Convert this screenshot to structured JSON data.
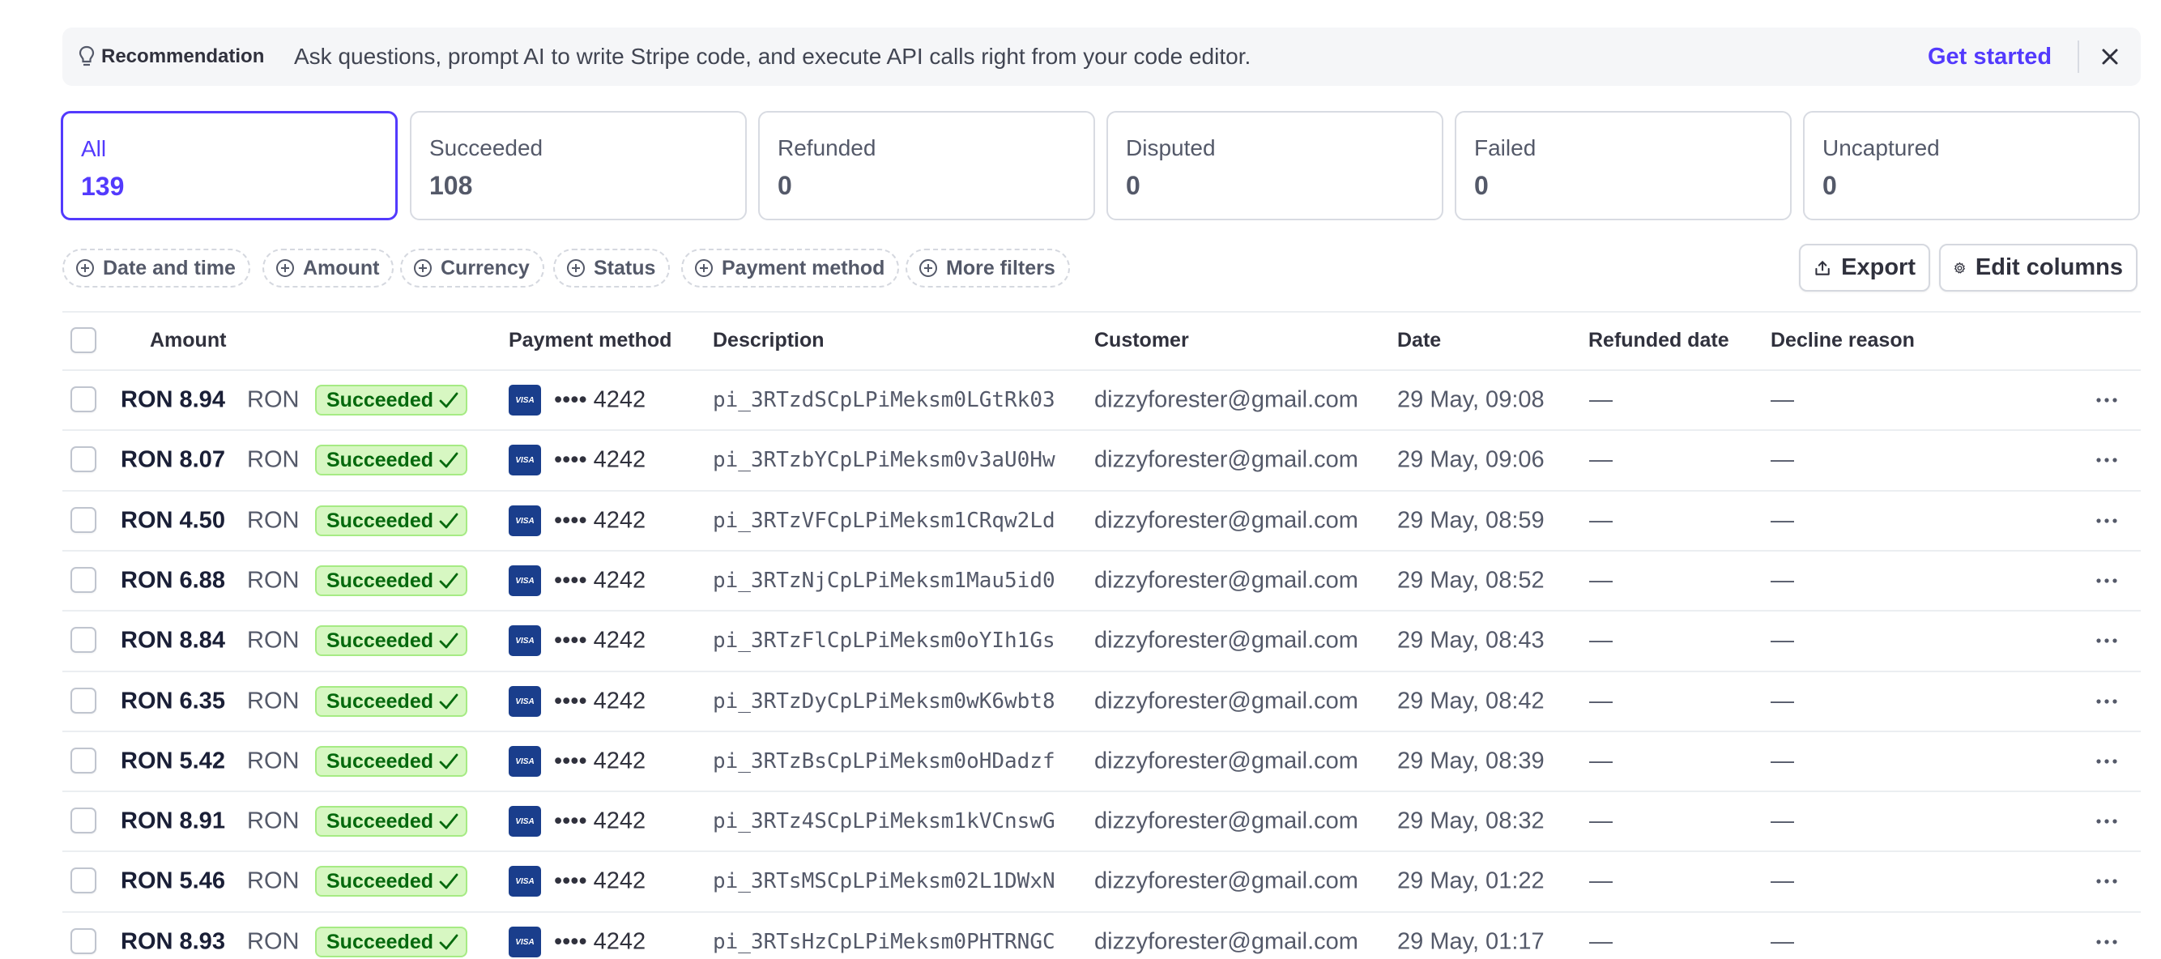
{
  "banner": {
    "label": "Recommendation",
    "text": "Ask questions, prompt AI to write Stripe code, and execute API calls right from your code editor.",
    "link": "Get started"
  },
  "status_cards": [
    {
      "label": "All",
      "count": "139",
      "active": true
    },
    {
      "label": "Succeeded",
      "count": "108",
      "active": false
    },
    {
      "label": "Refunded",
      "count": "0",
      "active": false
    },
    {
      "label": "Disputed",
      "count": "0",
      "active": false
    },
    {
      "label": "Failed",
      "count": "0",
      "active": false
    },
    {
      "label": "Uncaptured",
      "count": "0",
      "active": false
    }
  ],
  "filters": [
    "Date and time",
    "Amount",
    "Currency",
    "Status",
    "Payment method",
    "More filters"
  ],
  "actions": {
    "export": "Export",
    "edit_columns": "Edit columns"
  },
  "table": {
    "headers": {
      "amount": "Amount",
      "payment_method": "Payment method",
      "description": "Description",
      "customer": "Customer",
      "date": "Date",
      "refunded_date": "Refunded date",
      "decline_reason": "Decline reason"
    },
    "rows": [
      {
        "amount": "RON 8.94",
        "currency": "RON",
        "status": "Succeeded",
        "brand": "VISA",
        "last4": "•••• 4242",
        "description": "pi_3RTzdSCpLPiMeksm0LGtRk03",
        "customer": "dizzyforester@gmail.com",
        "date": "29 May, 09:08",
        "refunded_date": "—",
        "decline_reason": "—"
      },
      {
        "amount": "RON 8.07",
        "currency": "RON",
        "status": "Succeeded",
        "brand": "VISA",
        "last4": "•••• 4242",
        "description": "pi_3RTzbYCpLPiMeksm0v3aU0Hw",
        "customer": "dizzyforester@gmail.com",
        "date": "29 May, 09:06",
        "refunded_date": "—",
        "decline_reason": "—"
      },
      {
        "amount": "RON 4.50",
        "currency": "RON",
        "status": "Succeeded",
        "brand": "VISA",
        "last4": "•••• 4242",
        "description": "pi_3RTzVFCpLPiMeksm1CRqw2Ld",
        "customer": "dizzyforester@gmail.com",
        "date": "29 May, 08:59",
        "refunded_date": "—",
        "decline_reason": "—"
      },
      {
        "amount": "RON 6.88",
        "currency": "RON",
        "status": "Succeeded",
        "brand": "VISA",
        "last4": "•••• 4242",
        "description": "pi_3RTzNjCpLPiMeksm1Mau5id0",
        "customer": "dizzyforester@gmail.com",
        "date": "29 May, 08:52",
        "refunded_date": "—",
        "decline_reason": "—"
      },
      {
        "amount": "RON 8.84",
        "currency": "RON",
        "status": "Succeeded",
        "brand": "VISA",
        "last4": "•••• 4242",
        "description": "pi_3RTzFlCpLPiMeksm0oYIh1Gs",
        "customer": "dizzyforester@gmail.com",
        "date": "29 May, 08:43",
        "refunded_date": "—",
        "decline_reason": "—"
      },
      {
        "amount": "RON 6.35",
        "currency": "RON",
        "status": "Succeeded",
        "brand": "VISA",
        "last4": "•••• 4242",
        "description": "pi_3RTzDyCpLPiMeksm0wK6wbt8",
        "customer": "dizzyforester@gmail.com",
        "date": "29 May, 08:42",
        "refunded_date": "—",
        "decline_reason": "—"
      },
      {
        "amount": "RON 5.42",
        "currency": "RON",
        "status": "Succeeded",
        "brand": "VISA",
        "last4": "•••• 4242",
        "description": "pi_3RTzBsCpLPiMeksm0oHDadzf",
        "customer": "dizzyforester@gmail.com",
        "date": "29 May, 08:39",
        "refunded_date": "—",
        "decline_reason": "—"
      },
      {
        "amount": "RON 8.91",
        "currency": "RON",
        "status": "Succeeded",
        "brand": "VISA",
        "last4": "•••• 4242",
        "description": "pi_3RTz4SCpLPiMeksm1kVCnswG",
        "customer": "dizzyforester@gmail.com",
        "date": "29 May, 08:32",
        "refunded_date": "—",
        "decline_reason": "—"
      },
      {
        "amount": "RON 5.46",
        "currency": "RON",
        "status": "Succeeded",
        "brand": "VISA",
        "last4": "•••• 4242",
        "description": "pi_3RTsMSCpLPiMeksm02L1DWxN",
        "customer": "dizzyforester@gmail.com",
        "date": "29 May, 01:22",
        "refunded_date": "—",
        "decline_reason": "—"
      },
      {
        "amount": "RON 8.93",
        "currency": "RON",
        "status": "Succeeded",
        "brand": "VISA",
        "last4": "•••• 4242",
        "description": "pi_3RTsHzCpLPiMeksm0PHTRNGC",
        "customer": "dizzyforester@gmail.com",
        "date": "29 May, 01:17",
        "refunded_date": "—",
        "decline_reason": "—"
      }
    ]
  },
  "icons": {
    "banner": "lightbulb-icon",
    "close": "close-icon",
    "filter": "plus-circle-icon",
    "export": "export-icon",
    "edit_columns": "gear-icon",
    "status": "checkmark-icon",
    "row_actions": "more-horizontal-icon"
  },
  "colors": {
    "accent": "#533afd",
    "success_bg": "#d7f7c2",
    "success_text": "#05690d",
    "visa": "#1a3e8c"
  }
}
